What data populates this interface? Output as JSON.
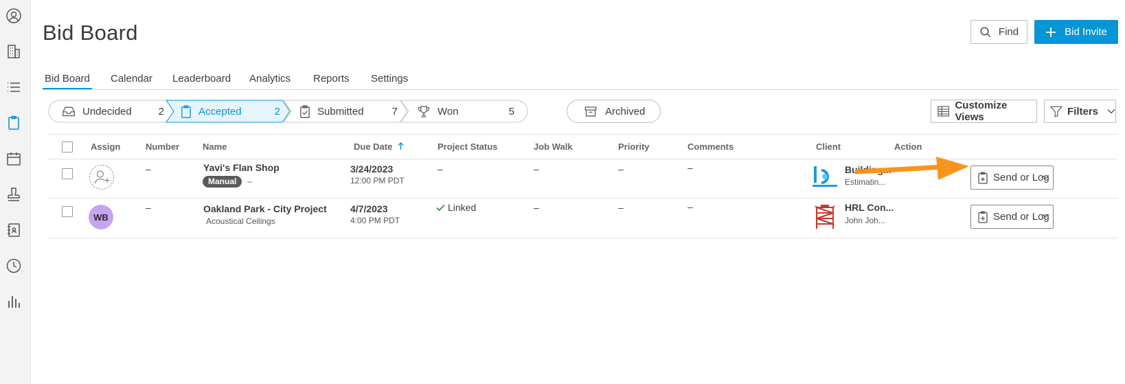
{
  "page": {
    "title": "Bid Board"
  },
  "header": {
    "find_label": "Find",
    "bid_invite_label": "Bid Invite"
  },
  "sidebar": {
    "icons": [
      "user-circle-icon",
      "building-icon",
      "list-icon",
      "clipboard-icon",
      "calendar-icon",
      "stamp-icon",
      "contacts-book-icon",
      "clock-icon",
      "bar-chart-icon"
    ],
    "active_index": 3,
    "active_color": "#0696d7"
  },
  "tabs": [
    {
      "label": "Bid Board",
      "active": true
    },
    {
      "label": "Calendar",
      "active": false
    },
    {
      "label": "Leaderboard",
      "active": false
    },
    {
      "label": "Analytics",
      "active": false
    },
    {
      "label": "Reports",
      "active": false
    },
    {
      "label": "Settings",
      "active": false
    }
  ],
  "pipeline": [
    {
      "label": "Undecided",
      "count": "2",
      "icon": "inbox-icon",
      "active": false
    },
    {
      "label": "Accepted",
      "count": "2",
      "icon": "clipboard-icon",
      "active": true
    },
    {
      "label": "Submitted",
      "count": "7",
      "icon": "clipboard-check-icon",
      "active": false
    },
    {
      "label": "Won",
      "count": "5",
      "icon": "trophy-icon",
      "active": false
    }
  ],
  "archived_label": "Archived",
  "customize_views_label": "Customize Views",
  "filters_label": "Filters",
  "table": {
    "columns": [
      "Assign",
      "Number",
      "Name",
      "Due Date",
      "Project Status",
      "Job Walk",
      "Priority",
      "Comments",
      "Client",
      "Action"
    ],
    "sort_column": "Due Date",
    "sort_direction": "ascending",
    "rows": [
      {
        "assign": "",
        "number": "–",
        "name": "Yavi's Flan Shop",
        "badge": "Manual",
        "subtitle": "–",
        "due_date": "3/24/2023",
        "due_time": "12:00 PM PDT",
        "project_status": "–",
        "job_walk": "–",
        "priority": "–",
        "comments": "–",
        "client_name": "Building...",
        "client_sub": "Estimatin...",
        "action_label": "Send or Log"
      },
      {
        "assign": "WB",
        "number": "–",
        "name": "Oakland Park - City Project",
        "badge": "",
        "subtitle": "Acoustical Ceilings",
        "due_date": "4/7/2023",
        "due_time": "4:00 PM PDT",
        "project_status": "Linked",
        "job_walk": "–",
        "priority": "–",
        "comments": "–",
        "client_name": "HRL Con...",
        "client_sub": "John Joh...",
        "action_label": "Send or Log"
      }
    ]
  },
  "colors": {
    "accent": "#0696d7",
    "annotation_arrow": "#f7941d",
    "avatar_wb": "#c8a3f0",
    "linked_check": "#3c8b3c"
  }
}
